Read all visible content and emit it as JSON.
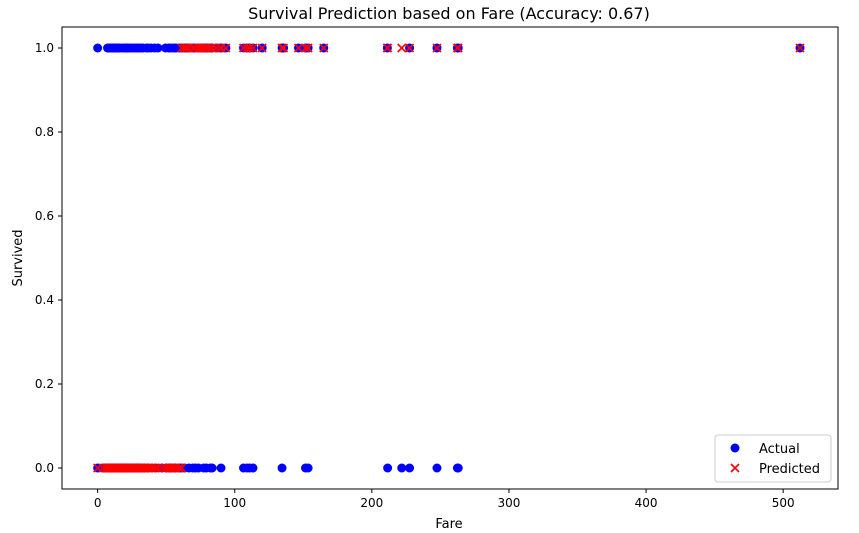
{
  "chart_data": {
    "type": "scatter",
    "title": "Survival Prediction based on Fare (Accuracy: 0.67)",
    "xlabel": "Fare",
    "ylabel": "Survived",
    "xlim": [
      -26,
      540
    ],
    "ylim": [
      -0.05,
      1.05
    ],
    "xticks": [
      0,
      100,
      200,
      300,
      400,
      500
    ],
    "xtick_labels": [
      "0",
      "100",
      "200",
      "300",
      "400",
      "500"
    ],
    "yticks": [
      0.0,
      0.2,
      0.4,
      0.6,
      0.8,
      1.0
    ],
    "ytick_labels": [
      "0.0",
      "0.2",
      "0.4",
      "0.6",
      "0.8",
      "1.0"
    ],
    "grid": false,
    "legend_position": "bottom-right",
    "series": [
      {
        "name": "Actual",
        "marker": "circle",
        "color": "#0000ff",
        "points": [
          [
            0,
            1
          ],
          [
            7.2,
            1
          ],
          [
            7.9,
            1
          ],
          [
            8.5,
            1
          ],
          [
            9.5,
            1
          ],
          [
            10.5,
            1
          ],
          [
            11.1,
            1
          ],
          [
            12.3,
            1
          ],
          [
            13,
            1
          ],
          [
            13.9,
            1
          ],
          [
            14.5,
            1
          ],
          [
            15.2,
            1
          ],
          [
            16.1,
            1
          ],
          [
            17.8,
            1
          ],
          [
            19.3,
            1
          ],
          [
            20.5,
            1
          ],
          [
            21.7,
            1
          ],
          [
            22.9,
            1
          ],
          [
            24.2,
            1
          ],
          [
            26,
            1
          ],
          [
            27.7,
            1
          ],
          [
            29.1,
            1
          ],
          [
            30.5,
            1
          ],
          [
            31.4,
            1
          ],
          [
            33,
            1
          ],
          [
            35.5,
            1
          ],
          [
            37,
            1
          ],
          [
            39,
            1
          ],
          [
            41.6,
            1
          ],
          [
            44,
            1
          ],
          [
            49.5,
            1
          ],
          [
            51.9,
            1
          ],
          [
            53.1,
            1
          ],
          [
            55,
            1
          ],
          [
            56.5,
            1
          ],
          [
            57,
            1
          ],
          [
            59.4,
            1
          ],
          [
            61.4,
            1
          ],
          [
            63.4,
            1
          ],
          [
            65,
            1
          ],
          [
            66.6,
            1
          ],
          [
            69.3,
            1
          ],
          [
            71,
            1
          ],
          [
            73.5,
            1
          ],
          [
            75.3,
            1
          ],
          [
            76.7,
            1
          ],
          [
            77.9,
            1
          ],
          [
            78.3,
            1
          ],
          [
            79.2,
            1
          ],
          [
            80,
            1
          ],
          [
            81.9,
            1
          ],
          [
            83.2,
            1
          ],
          [
            86.5,
            1
          ],
          [
            89.1,
            1
          ],
          [
            90,
            1
          ],
          [
            93.5,
            1
          ],
          [
            106.4,
            1
          ],
          [
            108.9,
            1
          ],
          [
            110.9,
            1
          ],
          [
            113.3,
            1
          ],
          [
            120,
            1
          ],
          [
            134.5,
            1
          ],
          [
            135.6,
            1
          ],
          [
            146.5,
            1
          ],
          [
            151.6,
            1
          ],
          [
            153.5,
            1
          ],
          [
            164.9,
            1
          ],
          [
            211.3,
            1
          ],
          [
            227.5,
            1
          ],
          [
            247.5,
            1
          ],
          [
            262.4,
            1
          ],
          [
            263,
            1
          ],
          [
            512.3,
            1
          ],
          [
            0,
            0
          ],
          [
            4,
            0
          ],
          [
            6.2,
            0
          ],
          [
            6.9,
            0
          ],
          [
            7.2,
            0
          ],
          [
            7.8,
            0
          ],
          [
            8.1,
            0
          ],
          [
            8.7,
            0
          ],
          [
            9.2,
            0
          ],
          [
            9.8,
            0
          ],
          [
            10.5,
            0
          ],
          [
            11.5,
            0
          ],
          [
            12.5,
            0
          ],
          [
            13,
            0
          ],
          [
            14,
            0
          ],
          [
            14.5,
            0
          ],
          [
            15.1,
            0
          ],
          [
            15.9,
            0
          ],
          [
            16.7,
            0
          ],
          [
            17.8,
            0
          ],
          [
            18.8,
            0
          ],
          [
            19.5,
            0
          ],
          [
            20.2,
            0
          ],
          [
            21,
            0
          ],
          [
            21.7,
            0
          ],
          [
            23,
            0
          ],
          [
            24.2,
            0
          ],
          [
            25.5,
            0
          ],
          [
            26.3,
            0
          ],
          [
            27.7,
            0
          ],
          [
            29,
            0
          ],
          [
            30.1,
            0
          ],
          [
            31.3,
            0
          ],
          [
            33.5,
            0
          ],
          [
            34.4,
            0
          ],
          [
            36.8,
            0
          ],
          [
            39.7,
            0
          ],
          [
            42.4,
            0
          ],
          [
            46.9,
            0
          ],
          [
            50,
            0
          ],
          [
            52,
            0
          ],
          [
            53.1,
            0
          ],
          [
            55.9,
            0
          ],
          [
            56.5,
            0
          ],
          [
            59.4,
            0
          ],
          [
            61.2,
            0
          ],
          [
            63.4,
            0
          ],
          [
            66.6,
            0
          ],
          [
            69.6,
            0
          ],
          [
            71.3,
            0
          ],
          [
            73.5,
            0
          ],
          [
            77.3,
            0
          ],
          [
            79.2,
            0
          ],
          [
            82.2,
            0
          ],
          [
            83.5,
            0
          ],
          [
            90,
            0
          ],
          [
            106.4,
            0
          ],
          [
            108.9,
            0
          ],
          [
            110.9,
            0
          ],
          [
            113.3,
            0
          ],
          [
            134.5,
            0
          ],
          [
            151.6,
            0
          ],
          [
            153.5,
            0
          ],
          [
            211.5,
            0
          ],
          [
            221.8,
            0
          ],
          [
            227.5,
            0
          ],
          [
            247.5,
            0
          ],
          [
            262.4,
            0
          ],
          [
            263,
            0
          ]
        ]
      },
      {
        "name": "Predicted",
        "marker": "x",
        "color": "#ff0000",
        "points": [
          [
            61.4,
            1
          ],
          [
            63.4,
            1
          ],
          [
            65,
            1
          ],
          [
            66.6,
            1
          ],
          [
            69.3,
            1
          ],
          [
            71,
            1
          ],
          [
            73.5,
            1
          ],
          [
            75.3,
            1
          ],
          [
            76.7,
            1
          ],
          [
            77.9,
            1
          ],
          [
            78.3,
            1
          ],
          [
            79.2,
            1
          ],
          [
            80,
            1
          ],
          [
            81.9,
            1
          ],
          [
            83.2,
            1
          ],
          [
            86.5,
            1
          ],
          [
            89.1,
            1
          ],
          [
            90,
            1
          ],
          [
            93.5,
            1
          ],
          [
            106.4,
            1
          ],
          [
            108.9,
            1
          ],
          [
            110.9,
            1
          ],
          [
            113.3,
            1
          ],
          [
            120,
            1
          ],
          [
            134.5,
            1
          ],
          [
            135.6,
            1
          ],
          [
            146.5,
            1
          ],
          [
            151.6,
            1
          ],
          [
            153.5,
            1
          ],
          [
            164.9,
            1
          ],
          [
            211.3,
            1
          ],
          [
            211.5,
            1
          ],
          [
            221.8,
            1
          ],
          [
            227.5,
            1
          ],
          [
            247.5,
            1
          ],
          [
            262.4,
            1
          ],
          [
            263,
            1
          ],
          [
            512.3,
            1
          ],
          [
            0,
            0
          ],
          [
            4,
            0
          ],
          [
            6.2,
            0
          ],
          [
            6.9,
            0
          ],
          [
            7.2,
            0
          ],
          [
            7.8,
            0
          ],
          [
            8.1,
            0
          ],
          [
            8.7,
            0
          ],
          [
            9.2,
            0
          ],
          [
            9.8,
            0
          ],
          [
            10.5,
            0
          ],
          [
            11.1,
            0
          ],
          [
            11.5,
            0
          ],
          [
            12.3,
            0
          ],
          [
            12.5,
            0
          ],
          [
            13,
            0
          ],
          [
            13.9,
            0
          ],
          [
            14,
            0
          ],
          [
            14.5,
            0
          ],
          [
            15.1,
            0
          ],
          [
            15.2,
            0
          ],
          [
            15.9,
            0
          ],
          [
            16.1,
            0
          ],
          [
            16.7,
            0
          ],
          [
            17.8,
            0
          ],
          [
            18.8,
            0
          ],
          [
            19.3,
            0
          ],
          [
            19.5,
            0
          ],
          [
            20.2,
            0
          ],
          [
            20.5,
            0
          ],
          [
            21,
            0
          ],
          [
            21.7,
            0
          ],
          [
            22.9,
            0
          ],
          [
            23,
            0
          ],
          [
            24.2,
            0
          ],
          [
            25.5,
            0
          ],
          [
            26,
            0
          ],
          [
            26.3,
            0
          ],
          [
            27.7,
            0
          ],
          [
            29,
            0
          ],
          [
            29.1,
            0
          ],
          [
            30.1,
            0
          ],
          [
            30.5,
            0
          ],
          [
            31.3,
            0
          ],
          [
            31.4,
            0
          ],
          [
            33,
            0
          ],
          [
            33.5,
            0
          ],
          [
            34.4,
            0
          ],
          [
            35.5,
            0
          ],
          [
            36.8,
            0
          ],
          [
            37,
            0
          ],
          [
            39,
            0
          ],
          [
            39.7,
            0
          ],
          [
            41.6,
            0
          ],
          [
            42.4,
            0
          ],
          [
            44,
            0
          ],
          [
            46.9,
            0
          ],
          [
            49.5,
            0
          ],
          [
            50,
            0
          ],
          [
            51.9,
            0
          ],
          [
            52,
            0
          ],
          [
            53.1,
            0
          ],
          [
            55,
            0
          ],
          [
            55.9,
            0
          ],
          [
            56.5,
            0
          ],
          [
            57,
            0
          ],
          [
            59.4,
            0
          ],
          [
            61.2,
            0
          ]
        ]
      }
    ]
  }
}
